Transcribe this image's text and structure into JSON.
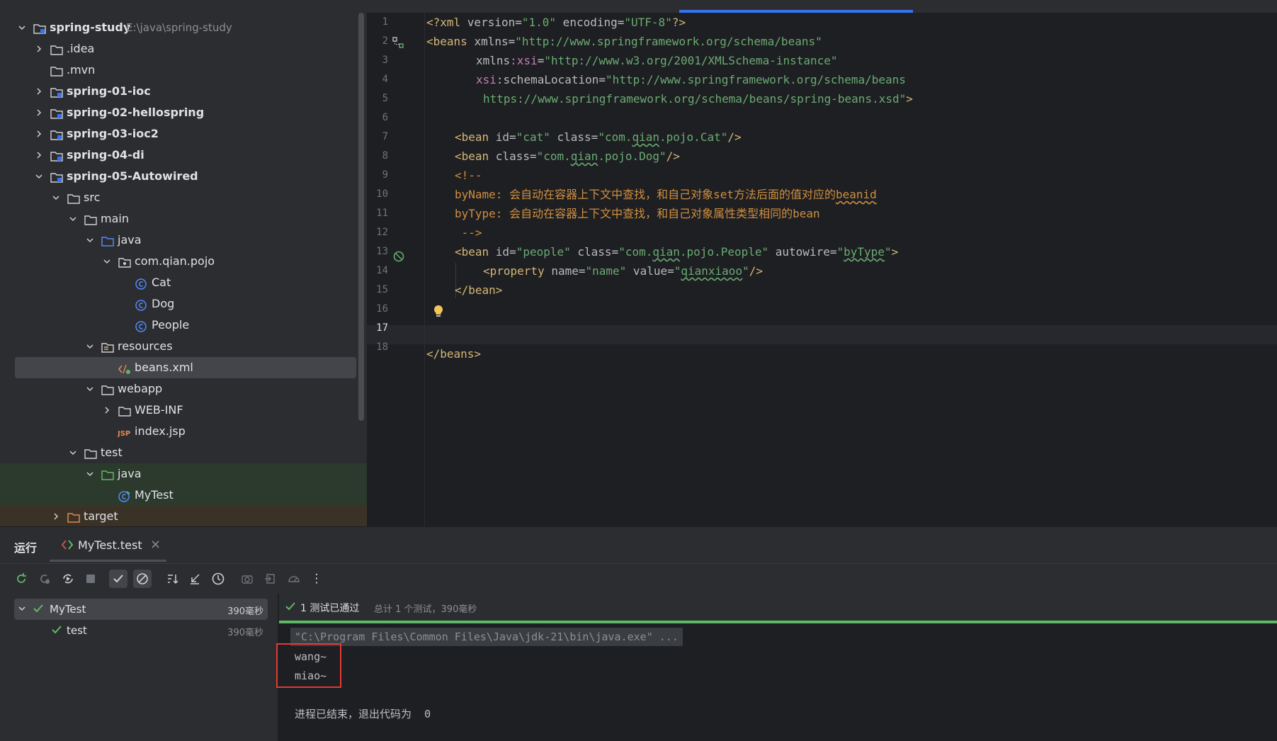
{
  "project_tree": {
    "root": {
      "label": "spring-study",
      "path": "E:\\java\\spring-study"
    },
    "items": [
      {
        "label": ".idea"
      },
      {
        "label": ".mvn"
      },
      {
        "label": "spring-01-ioc"
      },
      {
        "label": "spring-02-hellospring"
      },
      {
        "label": "spring-03-ioc2"
      },
      {
        "label": "spring-04-di"
      },
      {
        "label": "spring-05-Autowired"
      },
      {
        "label": "src"
      },
      {
        "label": "main"
      },
      {
        "label": "java"
      },
      {
        "label": "com.qian.pojo"
      },
      {
        "label": "Cat"
      },
      {
        "label": "Dog"
      },
      {
        "label": "People"
      },
      {
        "label": "resources"
      },
      {
        "label": "beans.xml"
      },
      {
        "label": "webapp"
      },
      {
        "label": "WEB-INF"
      },
      {
        "label": "index.jsp"
      },
      {
        "label": "test"
      },
      {
        "label": "java"
      },
      {
        "label": "MyTest"
      },
      {
        "label": "target"
      }
    ]
  },
  "editor": {
    "line_numbers": [
      "1",
      "2",
      "3",
      "4",
      "5",
      "6",
      "7",
      "8",
      "9",
      "10",
      "11",
      "12",
      "13",
      "14",
      "15",
      "16",
      "17",
      "18"
    ],
    "lines": {
      "l1": {
        "a": "<?xml ",
        "b": "version",
        "c": "=",
        "d": "\"1.0\"",
        "e": " encoding",
        "f": "=",
        "g": "\"UTF-8\"",
        "h": "?>"
      },
      "l2": {
        "a": "<beans ",
        "b": "xmlns",
        "c": "=",
        "d": "\"http://www.springframework.org/schema/beans\""
      },
      "l3": {
        "a": "xmlns",
        "b": ":xsi",
        "c": "=",
        "d": "\"http://www.w3.org/2001/XMLSchema-instance\""
      },
      "l4": {
        "a": "xsi",
        "b": ":schemaLocation",
        "c": "=",
        "d": "\"http://www.springframework.org/schema/beans"
      },
      "l5": {
        "a": "https://www.springframework.org/schema/beans/spring-beans.xsd\"",
        "b": ">"
      },
      "l7": {
        "a": "<bean ",
        "b": "id",
        "c": "=",
        "d": "\"cat\"",
        "e": " class",
        "f": "=",
        "g1": "\"com.",
        "g2": "qian",
        "g3": ".pojo.Cat\"",
        "h": "/>"
      },
      "l8": {
        "a": "<bean ",
        "b": "class",
        "c": "=",
        "d1": "\"com.",
        "d2": "qian",
        "d3": ".pojo.Dog\"",
        "e": "/>"
      },
      "l9": "<!--",
      "l10": {
        "a": "byName: 会自动在容器上下文中查找，和自己对象set方法后面的值对应的",
        "b": "beanid"
      },
      "l11": "byType: 会自动在容器上下文中查找，和自己对象属性类型相同的bean",
      "l12": " -->",
      "l13": {
        "a": "<bean ",
        "b": "id",
        "c": "=",
        "d": "\"people\"",
        "e": " class",
        "f": "=",
        "g1": "\"com.",
        "g2": "qian",
        "g3": ".pojo.People\"",
        "h": " autowire",
        "i": "=",
        "j1": "\"",
        "j2": "byType",
        "j3": "\"",
        "k": ">"
      },
      "l14": {
        "a": "<property ",
        "b": "name",
        "c": "=",
        "d": "\"name\"",
        "e": " value",
        "f": "=",
        "g1": "\"",
        "g2": "qianxiaoo",
        "g3": "\"",
        "h": "/>"
      },
      "l15": "</bean>",
      "l18": "</beans>"
    }
  },
  "run_panel": {
    "title": "运行",
    "tab_label": "MyTest.test",
    "test_tree": [
      {
        "label": "MyTest",
        "time": "390毫秒"
      },
      {
        "label": "test",
        "time": "390毫秒"
      }
    ],
    "status_passed": "1 测试已通过",
    "status_summary": "总计 1 个测试，390毫秒",
    "console": {
      "command": "\"C:\\Program Files\\Common Files\\Java\\jdk-21\\bin\\java.exe\" ...",
      "output": [
        "wang~",
        "miao~"
      ],
      "exit_message": "进程已结束，退出代码为  0"
    }
  },
  "colors": {
    "accent": "#3574f0",
    "pass_green": "#5fb865",
    "highlight_red": "#e53935"
  }
}
